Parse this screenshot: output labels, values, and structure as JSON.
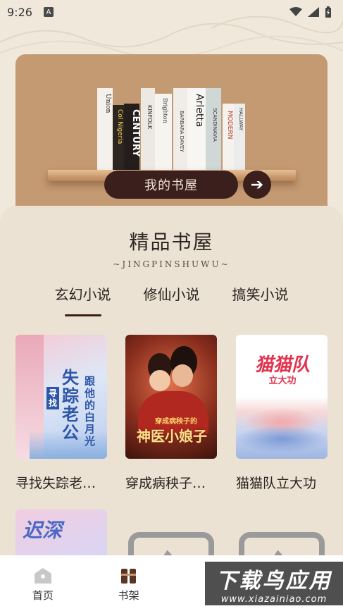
{
  "status": {
    "time": "9:26",
    "notif_icon": "a-icon"
  },
  "hero": {
    "shelf_button": "我的书屋",
    "spines": [
      "Union",
      "Col Nigeria",
      "CENTURY",
      "KINFOLK",
      "Brighton",
      "BARBARA DAVEY",
      "Arletta",
      "SCANDINAVIA",
      "MODERN",
      "HALLWAY"
    ]
  },
  "section": {
    "title": "精品书屋",
    "subtitle": "~JINGPINSHUWU~"
  },
  "tabs": [
    {
      "label": "玄幻小说",
      "active": true
    },
    {
      "label": "修仙小说",
      "active": false
    },
    {
      "label": "搞笑小说",
      "active": false
    }
  ],
  "books": [
    {
      "name": "寻找失踪老…",
      "cover_text": "失踪老公",
      "cover_text2": "跟他的白月光",
      "cover_tag": "寻找"
    },
    {
      "name": "穿成病秧子…",
      "cover_text": "神医小娘子",
      "cover_text2": "穿成病秧子的"
    },
    {
      "name": "猫猫队立大功",
      "cover_text": "猫猫队",
      "cover_text2": "立大功"
    }
  ],
  "second_row": {
    "cover_text": "迟深"
  },
  "nav": [
    {
      "label": "首页",
      "icon": "home-icon"
    },
    {
      "label": "书架",
      "icon": "bookshelf-icon"
    },
    {
      "label": "",
      "icon": ""
    },
    {
      "label": "",
      "icon": ""
    }
  ],
  "watermark": {
    "big": "下载鸟应用",
    "small": "www.xiazainiao.com"
  },
  "colors": {
    "accent": "#3a1f1c",
    "hero_bg": "#c49a73",
    "sheet_bg": "#ebe2d3"
  }
}
